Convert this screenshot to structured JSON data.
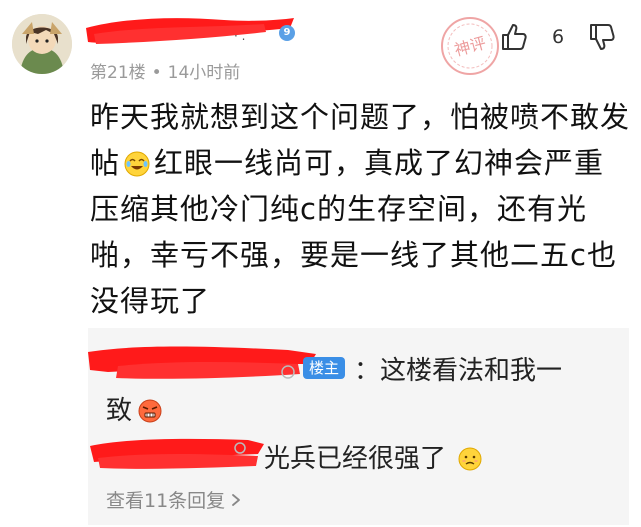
{
  "comment": {
    "username": "",
    "level_badge": "9",
    "floor": "第21楼",
    "time": "14小时前",
    "stamp_text": "神评",
    "likes": "6",
    "text_part1": "昨天我就想到这个问题了，怕被喷不敢发帖",
    "text_part2": "红眼一线尚可，真成了幻神会严重压缩其他冷门纯c的生存空间，还有光啪，幸亏不强，要是一线了其他二五c也没得玩了"
  },
  "replies": [
    {
      "author_tag": "楼主",
      "separator": "：",
      "text_line1": "这楼看法和我一",
      "text_line2": "致"
    },
    {
      "text": "光兵已经很强了"
    }
  ],
  "view_more": "查看11条回复",
  "icons": {
    "like": "thumb-up-icon",
    "dislike": "thumb-down-icon",
    "emoji1": "laughing-tears-emoji-icon",
    "emoji2": "angry-face-emoji-icon",
    "emoji3": "sad-face-emoji-icon"
  },
  "colors": {
    "redaction": "#ff1a1a",
    "badge_blue": "#3a8ee6",
    "stamp_red": "#e15b5b"
  }
}
